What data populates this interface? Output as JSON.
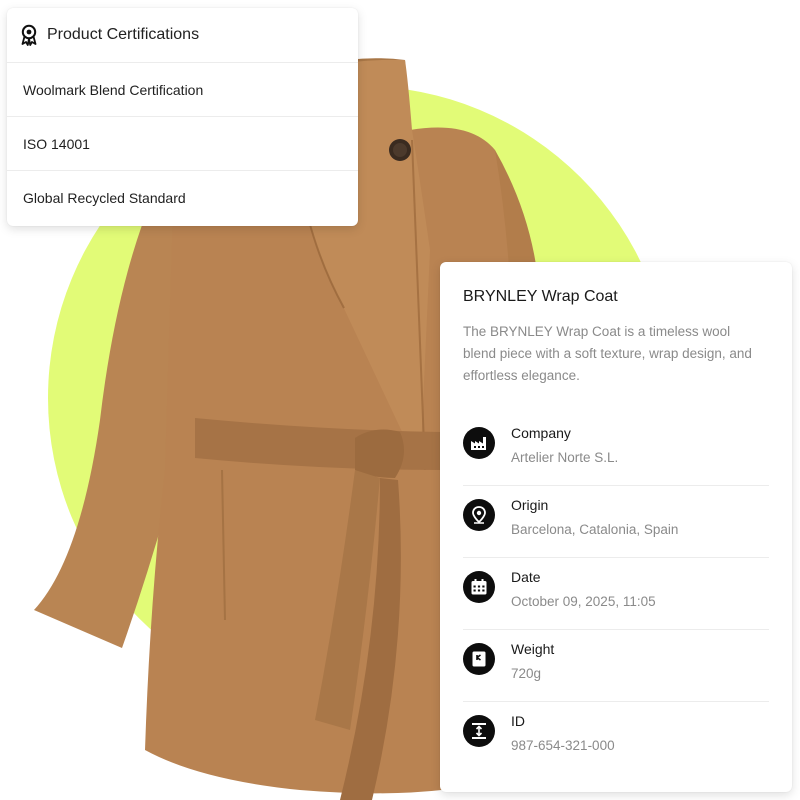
{
  "certifications": {
    "title": "Product Certifications",
    "items": [
      "Woolmark Blend Certification",
      "ISO 14001",
      "Global Recycled Standard"
    ]
  },
  "product": {
    "title": "BRYNLEY Wrap Coat",
    "description": "The BRYNLEY Wrap Coat is a timeless wool blend piece with a soft texture, wrap design, and effortless elegance.",
    "properties": [
      {
        "label": "Company",
        "value": "Artelier Norte S.L.",
        "icon": "factory-icon"
      },
      {
        "label": "Origin",
        "value": "Barcelona, Catalonia, Spain",
        "icon": "location-pin-icon"
      },
      {
        "label": "Date",
        "value": "October 09, 2025, 11:05",
        "icon": "calendar-icon"
      },
      {
        "label": "Weight",
        "value": "720g",
        "icon": "weight-icon"
      },
      {
        "label": "ID",
        "value": "987-654-321-000",
        "icon": "id-icon"
      }
    ]
  },
  "colors": {
    "accent_blob": "#e2fb77",
    "coat": "#b47f4e",
    "icon_bg": "#0d0d0d"
  }
}
